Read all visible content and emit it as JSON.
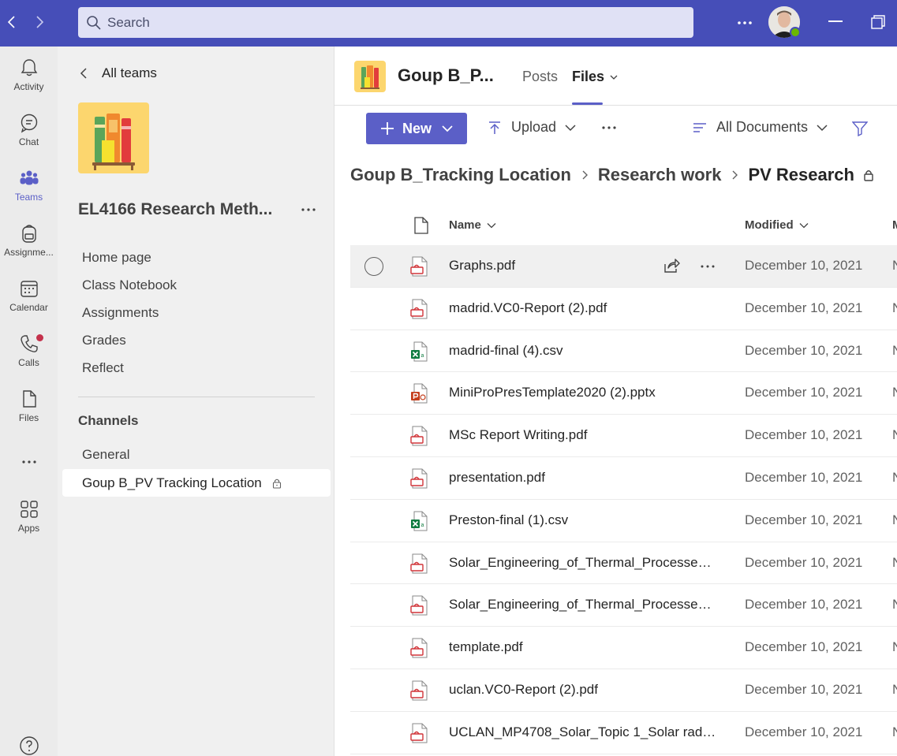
{
  "titlebar": {
    "search_placeholder": "Search"
  },
  "rail": {
    "items": [
      {
        "label": "Activity",
        "icon": "bell-icon"
      },
      {
        "label": "Chat",
        "icon": "chat-icon"
      },
      {
        "label": "Teams",
        "icon": "teams-icon",
        "active": true
      },
      {
        "label": "Assignme...",
        "icon": "backpack-icon"
      },
      {
        "label": "Calendar",
        "icon": "calendar-icon"
      },
      {
        "label": "Calls",
        "icon": "phone-icon",
        "badge": true
      },
      {
        "label": "Files",
        "icon": "file-icon"
      },
      {
        "label": "Apps",
        "icon": "apps-icon"
      }
    ]
  },
  "team_panel": {
    "back_label": "All teams",
    "team_name": "EL4166 Research Meth...",
    "links": [
      "Home page",
      "Class Notebook",
      "Assignments",
      "Grades",
      "Reflect"
    ],
    "channels_heading": "Channels",
    "channels": [
      "General",
      "Goup B_PV Tracking Location"
    ]
  },
  "channel_header": {
    "title": "Goup B_P...",
    "tabs": [
      "Posts",
      "Files"
    ]
  },
  "toolbar": {
    "new_label": "New",
    "upload_label": "Upload",
    "view_label": "All Documents"
  },
  "breadcrumb": [
    "Goup B_Tracking Location",
    "Research work",
    "PV Research"
  ],
  "columns": {
    "name": "Name",
    "modified": "Modified",
    "extra": "M"
  },
  "files": [
    {
      "name": "Graphs.pdf",
      "type": "pdf",
      "modified": "December 10, 2021",
      "extra": "N"
    },
    {
      "name": "madrid.VC0-Report (2).pdf",
      "type": "pdf",
      "modified": "December 10, 2021",
      "extra": "N"
    },
    {
      "name": "madrid-final (4).csv",
      "type": "csv",
      "modified": "December 10, 2021",
      "extra": "N"
    },
    {
      "name": "MiniProPresTemplate2020 (2).pptx",
      "type": "pptx",
      "modified": "December 10, 2021",
      "extra": "N"
    },
    {
      "name": "MSc Report Writing.pdf",
      "type": "pdf",
      "modified": "December 10, 2021",
      "extra": "N"
    },
    {
      "name": "presentation.pdf",
      "type": "pdf",
      "modified": "December 10, 2021",
      "extra": "N"
    },
    {
      "name": "Preston-final (1).csv",
      "type": "csv",
      "modified": "December 10, 2021",
      "extra": "N"
    },
    {
      "name": "Solar_Engineering_of_Thermal_Processe…",
      "type": "pdf",
      "modified": "December 10, 2021",
      "extra": "N"
    },
    {
      "name": "Solar_Engineering_of_Thermal_Processe…",
      "type": "pdf",
      "modified": "December 10, 2021",
      "extra": "N"
    },
    {
      "name": "template.pdf",
      "type": "pdf",
      "modified": "December 10, 2021",
      "extra": "N"
    },
    {
      "name": "uclan.VC0-Report (2).pdf",
      "type": "pdf",
      "modified": "December 10, 2021",
      "extra": "N"
    },
    {
      "name": "UCLAN_MP4708_Solar_Topic 1_Solar rad…",
      "type": "pdf",
      "modified": "December 10, 2021",
      "extra": "N"
    }
  ],
  "colors": {
    "brand": "#464eb8",
    "accent": "#5b5fc7",
    "pdf": "#d13438",
    "excel": "#107c41",
    "powerpoint": "#c43e1c"
  }
}
